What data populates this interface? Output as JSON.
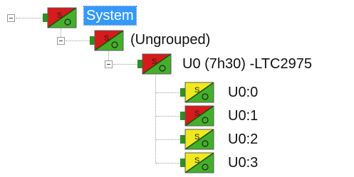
{
  "tree": {
    "root": {
      "label": "System",
      "icon": "status-red-green-icon",
      "selected": true
    },
    "group": {
      "label": "(Ungrouped)",
      "icon": "status-red-green-icon"
    },
    "device": {
      "label": "U0 (7h30) -LTC2975",
      "icon": "status-red-green-icon"
    },
    "channels": [
      {
        "label": "U0:0",
        "icon": "status-yellow-green-icon"
      },
      {
        "label": "U0:1",
        "icon": "status-red-green-icon"
      },
      {
        "label": "U0:2",
        "icon": "status-yellow-green-icon"
      },
      {
        "label": "U0:3",
        "icon": "status-yellow-green-icon"
      }
    ]
  },
  "icon_text": "S",
  "colors": {
    "red": "#d71a1a",
    "yellow": "#f0e820",
    "green": "#43b02a",
    "selection": "#3399ff"
  }
}
